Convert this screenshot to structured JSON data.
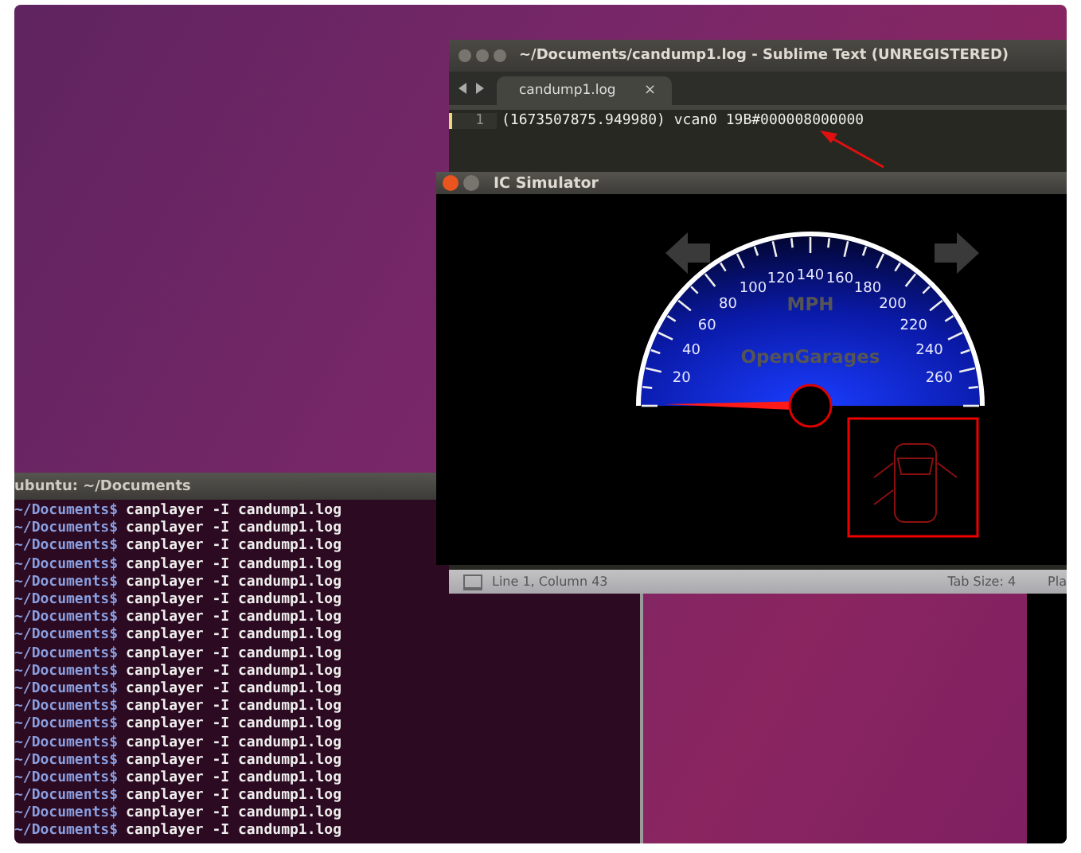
{
  "editor_window": {
    "title": "~/Documents/candump1.log - Sublime Text (UNREGISTERED)",
    "tabs": [
      {
        "label": "candump1.log",
        "selected": true,
        "close": "×"
      }
    ],
    "lines": [
      {
        "number": "1",
        "text": "(1673507875.949980) vcan0 19B#000008000000"
      }
    ],
    "status_bar": {
      "position": "Line 1, Column 43",
      "tab_size": "Tab Size: 4",
      "syntax": "Pla"
    }
  },
  "simulator_window": {
    "title": "IC Simulator",
    "gauge": {
      "unit": "MPH",
      "brand": "OpenGarages",
      "labels": [
        "20",
        "40",
        "60",
        "80",
        "100",
        "120",
        "140",
        "160",
        "180",
        "200",
        "220",
        "240",
        "260"
      ]
    },
    "turn_signals": [
      {
        "kind": "left",
        "on": false
      },
      {
        "kind": "right",
        "on": false
      }
    ]
  },
  "terminal_window": {
    "title": "ubuntu: ~/Documents",
    "lines": [
      {
        "prompt": "~/Documents$",
        "command": "canplayer -I candump1.log"
      },
      {
        "prompt": "~/Documents$",
        "command": "canplayer -I candump1.log"
      },
      {
        "prompt": "~/Documents$",
        "command": "canplayer -I candump1.log"
      },
      {
        "prompt": "~/Documents$",
        "command": "canplayer -I candump1.log"
      },
      {
        "prompt": "~/Documents$",
        "command": "canplayer -I candump1.log"
      },
      {
        "prompt": "~/Documents$",
        "command": "canplayer -I candump1.log"
      },
      {
        "prompt": "~/Documents$",
        "command": "canplayer -I candump1.log"
      },
      {
        "prompt": "~/Documents$",
        "command": "canplayer -I candump1.log"
      },
      {
        "prompt": "~/Documents$",
        "command": "canplayer -I candump1.log"
      },
      {
        "prompt": "~/Documents$",
        "command": "canplayer -I candump1.log"
      },
      {
        "prompt": "~/Documents$",
        "command": "canplayer -I candump1.log"
      },
      {
        "prompt": "~/Documents$",
        "command": "canplayer -I candump1.log"
      },
      {
        "prompt": "~/Documents$",
        "command": "canplayer -I candump1.log"
      },
      {
        "prompt": "~/Documents$",
        "command": "canplayer -I candump1.log"
      },
      {
        "prompt": "~/Documents$",
        "command": "canplayer -I candump1.log"
      },
      {
        "prompt": "~/Documents$",
        "command": "canplayer -I candump1.log"
      },
      {
        "prompt": "~/Documents$",
        "command": "canplayer -I candump1.log"
      },
      {
        "prompt": "~/Documents$",
        "command": "canplayer -I candump1.log"
      },
      {
        "prompt": "~/Documents$",
        "command": "canplayer -I candump1.log"
      }
    ]
  }
}
